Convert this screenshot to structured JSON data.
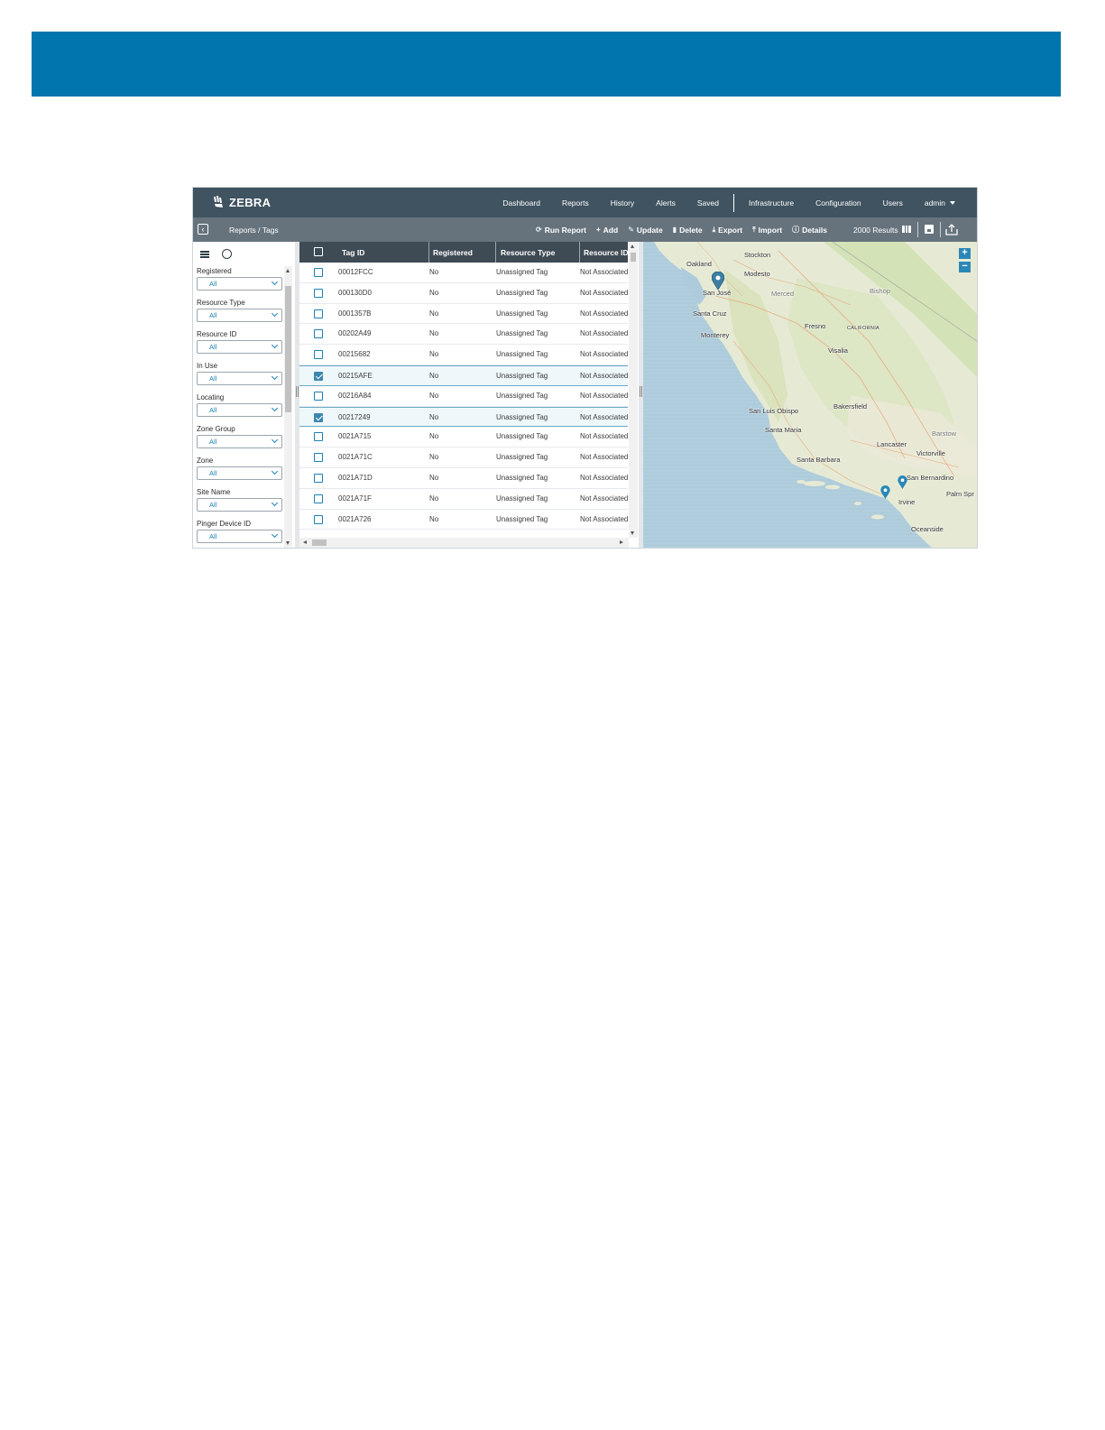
{
  "topnav": {
    "logo_text": "ZEBRA",
    "items": [
      "Dashboard",
      "Reports",
      "History",
      "Alerts",
      "Saved"
    ],
    "items_right": [
      "Infrastructure",
      "Configuration",
      "Users"
    ],
    "user": "admin"
  },
  "toolbar": {
    "breadcrumb": "Reports / Tags",
    "actions": [
      {
        "label": "Run Report",
        "icon": "refresh-icon"
      },
      {
        "label": "Add",
        "icon": "plus-icon"
      },
      {
        "label": "Update",
        "icon": "pencil-icon"
      },
      {
        "label": "Delete",
        "icon": "trash-icon"
      },
      {
        "label": "Export",
        "icon": "download-icon"
      },
      {
        "label": "Import",
        "icon": "upload-icon"
      },
      {
        "label": "Details",
        "icon": "info-icon"
      }
    ],
    "results": "2000 Results"
  },
  "filters": [
    {
      "label": "Registered",
      "value": "All"
    },
    {
      "label": "Resource Type",
      "value": "All"
    },
    {
      "label": "Resource ID",
      "value": "All"
    },
    {
      "label": "In Use",
      "value": "All"
    },
    {
      "label": "Locating",
      "value": "All"
    },
    {
      "label": "Zone Group",
      "value": "All"
    },
    {
      "label": "Zone",
      "value": "All"
    },
    {
      "label": "Site Name",
      "value": "All"
    },
    {
      "label": "Pinger Device ID",
      "value": "All"
    }
  ],
  "table": {
    "columns": [
      "Tag ID",
      "Registered",
      "Resource Type",
      "Resource ID"
    ],
    "rows": [
      {
        "tag": "00012FCC",
        "registered": "No",
        "type": "Unassigned Tag",
        "resource": "Not Associated",
        "checked": false
      },
      {
        "tag": "000130D0",
        "registered": "No",
        "type": "Unassigned Tag",
        "resource": "Not Associated",
        "checked": false
      },
      {
        "tag": "0001357B",
        "registered": "No",
        "type": "Unassigned Tag",
        "resource": "Not Associated",
        "checked": false
      },
      {
        "tag": "00202A49",
        "registered": "No",
        "type": "Unassigned Tag",
        "resource": "Not Associated",
        "checked": false
      },
      {
        "tag": "00215682",
        "registered": "No",
        "type": "Unassigned Tag",
        "resource": "Not Associated",
        "checked": false
      },
      {
        "tag": "00215AFE",
        "registered": "No",
        "type": "Unassigned Tag",
        "resource": "Not Associated",
        "checked": true
      },
      {
        "tag": "00216A84",
        "registered": "No",
        "type": "Unassigned Tag",
        "resource": "Not Associated",
        "checked": false
      },
      {
        "tag": "00217249",
        "registered": "No",
        "type": "Unassigned Tag",
        "resource": "Not Associated",
        "checked": true
      },
      {
        "tag": "0021A715",
        "registered": "No",
        "type": "Unassigned Tag",
        "resource": "Not Associated",
        "checked": false
      },
      {
        "tag": "0021A71C",
        "registered": "No",
        "type": "Unassigned Tag",
        "resource": "Not Associated",
        "checked": false
      },
      {
        "tag": "0021A71D",
        "registered": "No",
        "type": "Unassigned Tag",
        "resource": "Not Associated",
        "checked": false
      },
      {
        "tag": "0021A71F",
        "registered": "No",
        "type": "Unassigned Tag",
        "resource": "Not Associated",
        "checked": false
      },
      {
        "tag": "0021A726",
        "registered": "No",
        "type": "Unassigned Tag",
        "resource": "Not Associated",
        "checked": false
      }
    ]
  },
  "map": {
    "cities": [
      "Stockton",
      "Oakland",
      "Modesto",
      "San José",
      "Merced",
      "Bishop",
      "Santa Cruz",
      "Fresno",
      "CALIFORNIA",
      "Monterey",
      "Visalia",
      "Bakersfield",
      "San Luis Obispo",
      "Santa Maria",
      "Barstow",
      "Lancaster",
      "Victorville",
      "Santa Barbara",
      "San Bernardino",
      "Irvine",
      "Palm Spr",
      "Oceanside"
    ],
    "zoom_in": "+",
    "zoom_out": "−"
  },
  "colors": {
    "banner": "#0176ae",
    "nav": "#3f5360",
    "toolbar": "#66737d",
    "accent": "#1c80b5",
    "pin": "#2a87b8"
  }
}
